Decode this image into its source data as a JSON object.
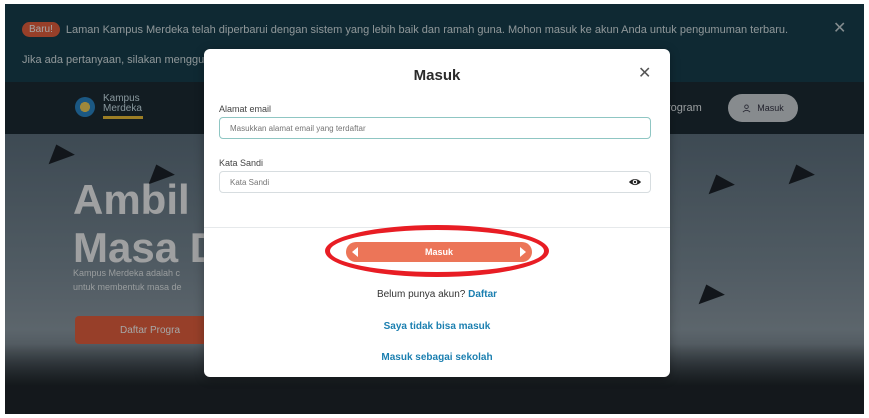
{
  "banner": {
    "badge": "Baru!",
    "message": "Laman Kampus Merdeka telah diperbarui dengan sistem yang lebih baik dan ramah guna. Mohon masuk ke akun Anda untuk pengumuman terbaru.",
    "help_text": "Jika ada pertanyaan, silakan menggun",
    "close_glyph": "✕"
  },
  "navbar": {
    "logo_text": "Kampus Merdeka",
    "program_label": "rogram",
    "login_label": "Masuk",
    "login_icon": "user-icon"
  },
  "hero": {
    "title_line1": "Ambil I",
    "title_line2": "Masa D",
    "desc_line1": "Kampus Merdeka adalah c",
    "desc_line2": "untuk membentuk masa de",
    "cta_label": "Daftar Progra"
  },
  "modal": {
    "title": "Masuk",
    "close_glyph": "✕",
    "email_label": "Alamat email",
    "email_placeholder": "Masukkan alamat email yang terdaftar",
    "email_value": "",
    "password_label": "Kata Sandi",
    "password_placeholder": "Kata Sandi",
    "password_value": "",
    "submit_label": "Masuk",
    "signup_prompt": "Belum punya akun?",
    "signup_link": "Daftar",
    "cannot_login_link": "Saya tidak bisa masuk",
    "school_login_link": "Masuk sebagai sekolah"
  },
  "colors": {
    "accent": "#ec7558",
    "link": "#1b7fb0",
    "highlight": "#e81d24",
    "banner_bg": "#17404f"
  }
}
